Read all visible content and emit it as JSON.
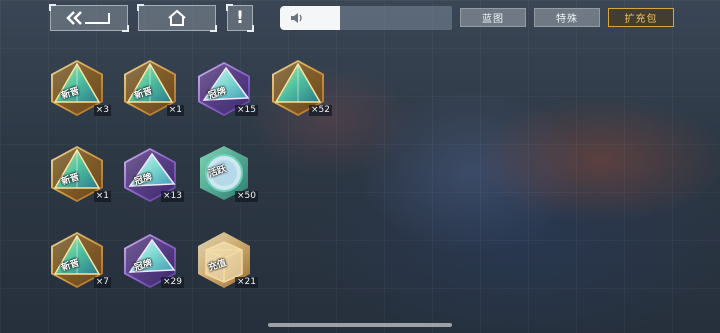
{
  "toolbar": {
    "back_icon": "double-chevron-left-back-icon",
    "home_icon": "home-icon",
    "alert_label": "!",
    "volume_level": 0.35
  },
  "tabs": [
    {
      "label": "蓝图",
      "selected": false
    },
    {
      "label": "特殊",
      "selected": false
    },
    {
      "label": "扩充包",
      "selected": true
    }
  ],
  "colors": {
    "selected_tab": "#d8a63e",
    "tab": "#8c96a0"
  },
  "items": [
    {
      "type": "gold-pyramid",
      "tag": "新晋",
      "count": "×3"
    },
    {
      "type": "gold-pyramid",
      "tag": "新晋",
      "count": "×1"
    },
    {
      "type": "purple-pyramid",
      "tag": "冠牌",
      "count": "×15"
    },
    {
      "type": "gold-pyramid-plain",
      "tag": "",
      "count": "×52"
    },
    {
      "type": "gold-pyramid",
      "tag": "新晋",
      "count": "×1"
    },
    {
      "type": "purple-pyramid",
      "tag": "冠牌",
      "count": "×13"
    },
    {
      "type": "green-badge",
      "tag": "活跃",
      "count": "×50"
    },
    {
      "type": "gold-pyramid",
      "tag": "新晋",
      "count": "×7"
    },
    {
      "type": "purple-pyramid",
      "tag": "冠牌",
      "count": "×29"
    },
    {
      "type": "gold-box",
      "tag": "充值",
      "count": "×21"
    }
  ]
}
